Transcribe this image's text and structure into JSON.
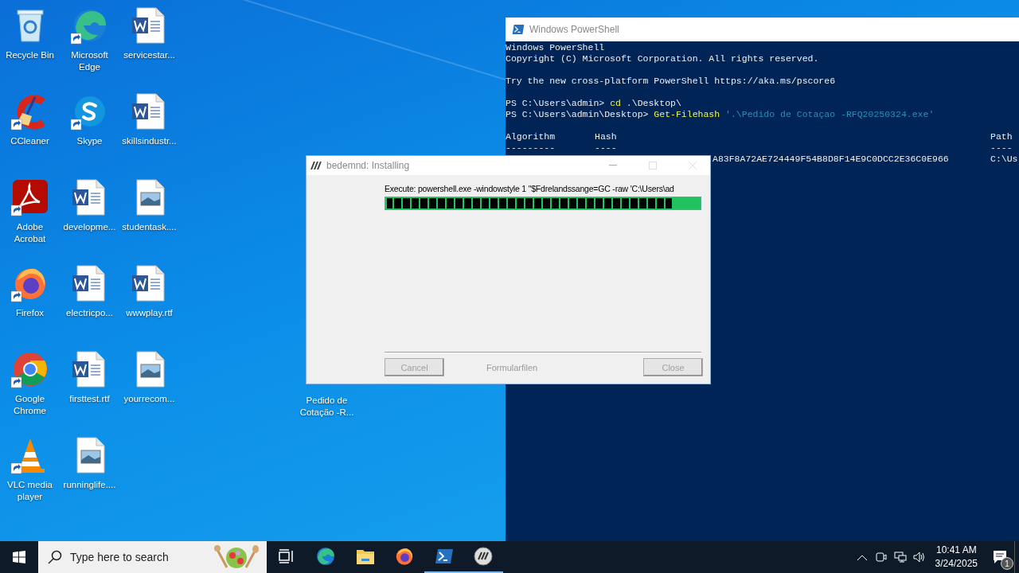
{
  "desktop_icons": [
    {
      "label": "Recycle Bin",
      "kind": "recycle",
      "shortcut": false
    },
    {
      "label": "CCleaner",
      "kind": "ccleaner",
      "shortcut": true
    },
    {
      "label": "Adobe Acrobat",
      "kind": "acrobat",
      "shortcut": true
    },
    {
      "label": "Firefox",
      "kind": "firefox",
      "shortcut": true
    },
    {
      "label": "Google Chrome",
      "kind": "chrome",
      "shortcut": true
    },
    {
      "label": "VLC media player",
      "kind": "vlc",
      "shortcut": true
    },
    {
      "label": "Microsoft Edge",
      "kind": "edge",
      "shortcut": true
    },
    {
      "label": "Skype",
      "kind": "skype",
      "shortcut": true
    },
    {
      "label": "developme...",
      "kind": "word",
      "shortcut": false
    },
    {
      "label": "electricpo...",
      "kind": "word",
      "shortcut": false
    },
    {
      "label": "firsttest.rtf",
      "kind": "word",
      "shortcut": false
    },
    {
      "label": "runninglife....",
      "kind": "image",
      "shortcut": false
    },
    {
      "label": "servicestar...",
      "kind": "word",
      "shortcut": false
    },
    {
      "label": "skillsindustr...",
      "kind": "word",
      "shortcut": false
    },
    {
      "label": "studentask....",
      "kind": "image",
      "shortcut": false
    },
    {
      "label": "wwwplay.rtf",
      "kind": "word",
      "shortcut": false
    },
    {
      "label": "yourrecom...",
      "kind": "image",
      "shortcut": false
    }
  ],
  "covered_icon": {
    "label": "Pedido de Cotação -R..."
  },
  "powershell": {
    "title": "Windows PowerShell",
    "blocks": [
      [
        [
          {
            "kind": "text",
            "text": "Windows PowerShell"
          }
        ],
        [
          {
            "kind": "text",
            "text": "Copyright (C) Microsoft Corporation. All rights reserved."
          }
        ]
      ],
      [
        [
          {
            "kind": "text",
            "text": "Try the new cross-platform PowerShell https://aka.ms/pscore6"
          }
        ]
      ],
      [
        [
          {
            "kind": "text",
            "text": "PS C:\\Users\\admin>"
          },
          {
            "kind": "command",
            "text": " cd"
          },
          {
            "kind": "text",
            "text": " .\\Desktop\\"
          }
        ],
        [
          {
            "kind": "text",
            "text": "PS C:\\Users\\admin\\Desktop>"
          },
          {
            "kind": "command",
            "text": " Get-Filehash"
          },
          {
            "kind": "string",
            "text": " '.\\Pedido de Cotaçao -RFQ20250324.exe'"
          }
        ]
      ]
    ],
    "table": {
      "columns": [
        {
          "header": "Algorithm",
          "rule": "---------"
        },
        {
          "header": "Hash",
          "rule": "----"
        },
        {
          "header": "Path",
          "rule": "----"
        }
      ],
      "row": {
        "hash": "A83F8A72AE724449F54B8D8F14E9C0DCC2E36C0E966",
        "path": "C:\\Us"
      }
    }
  },
  "installer": {
    "title": "bedemnd: Installing",
    "status": "Execute: powershell.exe -windowstyle 1 \"$Fdrelandssange=GC -raw 'C:\\Users\\ad",
    "progress": {
      "level": 0.91
    },
    "branding": "Formularfilen",
    "buttons": [
      {
        "label": "Cancel",
        "disabled": true
      },
      {
        "label": "Close",
        "disabled": true
      }
    ]
  },
  "taskbar": {
    "search": {
      "placeholder": "Type here to search"
    },
    "apps": [
      {
        "kind": "taskview",
        "running": false
      },
      {
        "kind": "edge",
        "running": false
      },
      {
        "kind": "explorer",
        "running": false
      },
      {
        "kind": "firefox",
        "running": false
      },
      {
        "kind": "powershell",
        "running": true
      },
      {
        "kind": "installer",
        "running": true
      }
    ],
    "tray": {
      "time": "10:41 AM",
      "date": "3/24/2025",
      "notifications": "1"
    }
  }
}
